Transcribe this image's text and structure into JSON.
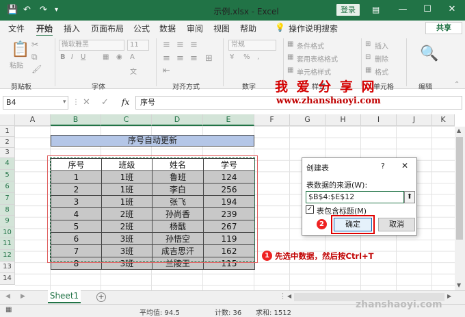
{
  "window": {
    "title": "示例.xlsx - Excel",
    "login_label": "登录",
    "min_label": "—",
    "max_label": "☐",
    "close_label": "✕"
  },
  "quick_access": {
    "save_icon": "save-icon",
    "undo_icon": "undo-icon",
    "redo_icon": "redo-icon",
    "customize_icon": "chevron-down-icon"
  },
  "menu": {
    "items": [
      "文件",
      "开始",
      "插入",
      "页面布局",
      "公式",
      "数据",
      "审阅",
      "视图",
      "帮助",
      "操作说明搜索"
    ],
    "share_label": "共享",
    "active": "开始"
  },
  "ribbon": {
    "clipboard": {
      "label": "剪贴板",
      "paste_label": "粘贴"
    },
    "font": {
      "label": "字体",
      "font_name": "微软雅黑",
      "font_size": "11"
    },
    "alignment": {
      "label": "对齐方式"
    },
    "number": {
      "label": "数字",
      "format": "常规"
    },
    "styles": {
      "label": "样式",
      "conditional": "条件格式",
      "table_format": "套用表格格式",
      "cell_style": "单元格样式"
    },
    "cells": {
      "label": "单元格",
      "insert": "插入",
      "delete": "删除",
      "format": "格式"
    },
    "editing": {
      "label": "编辑"
    }
  },
  "watermark": {
    "top": "我 爱 分 享 网",
    "url": "www.zhanshaoyi.com",
    "bottom": "zhanshaoyi.com"
  },
  "formula_bar": {
    "name_box": "B4",
    "fx_label": "fx",
    "value": "序号"
  },
  "sheet": {
    "columns": [
      "A",
      "B",
      "C",
      "D",
      "E",
      "F",
      "G",
      "H",
      "I",
      "J",
      "K"
    ],
    "rows": [
      "1",
      "2",
      "3",
      "4",
      "5",
      "6",
      "7",
      "8",
      "9",
      "10",
      "11",
      "12",
      "13",
      "14"
    ],
    "title_cell": "序号自动更新",
    "table_headers": [
      "序号",
      "班级",
      "姓名",
      "学号"
    ],
    "table_rows": [
      [
        "1",
        "1班",
        "鲁班",
        "124"
      ],
      [
        "2",
        "1班",
        "李白",
        "256"
      ],
      [
        "3",
        "1班",
        "张飞",
        "194"
      ],
      [
        "4",
        "2班",
        "孙尚香",
        "239"
      ],
      [
        "5",
        "2班",
        "杨戬",
        "267"
      ],
      [
        "6",
        "3班",
        "孙悟空",
        "119"
      ],
      [
        "7",
        "3班",
        "成吉思汗",
        "162"
      ],
      [
        "8",
        "3班",
        "兰陵王",
        "115"
      ]
    ],
    "tab_name": "Sheet1"
  },
  "dialog": {
    "title": "创建表",
    "help": "?",
    "close": "✕",
    "source_label": "表数据的来源(W):",
    "source_value": "$B$4:$E$12",
    "header_checkbox_label": "表包含标题(M)",
    "header_checked": true,
    "ok_label": "确定",
    "cancel_label": "取消"
  },
  "annotations": {
    "step1_number": "1",
    "step1_text": "先选中数据，然后按Ctrl+T",
    "step2_number": "2"
  },
  "status": {
    "average": "平均值: 94.5",
    "count": "计数: 36",
    "sum": "求和: 1512"
  },
  "colors": {
    "accent": "#217346",
    "header_fill": "#b4c6e7",
    "annotation_red": "#e00000"
  }
}
